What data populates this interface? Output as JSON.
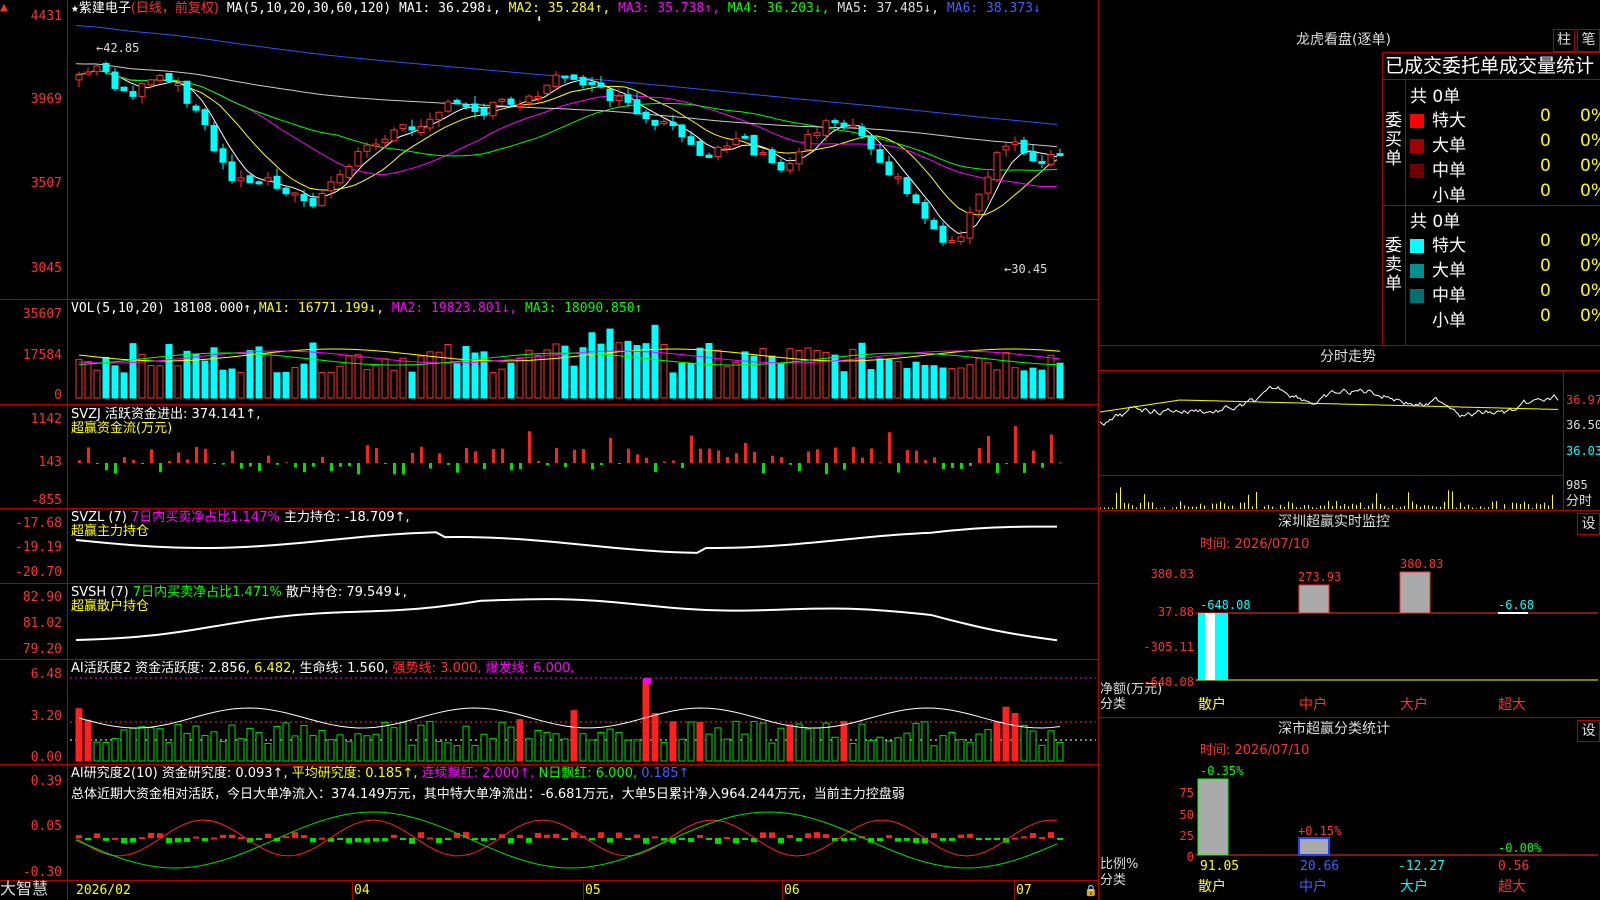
{
  "stock": {
    "star": "★",
    "name": "紫建电子",
    "period": "(日线，前复权)",
    "ma_header": "MA(5,10,20,30,60,120)",
    "ma_items": [
      {
        "label": "MA1: 36.298↓,",
        "color": "#ffffff"
      },
      {
        "label": "MA2: 35.284↑,",
        "color": "#ffff00"
      },
      {
        "label": "MA3: 35.738↑,",
        "color": "#ff00ff"
      },
      {
        "label": "MA4: 36.203↓,",
        "color": "#00ff00"
      },
      {
        "label": "MA5: 37.485↓,",
        "color": "#dddddd"
      },
      {
        "label": "MA6: 38.373↓",
        "color": "#4060ff"
      }
    ],
    "price_axis": [
      "4431",
      "3969",
      "3507",
      "3045"
    ],
    "high_marker": "←42.85",
    "low_marker": "←30.45"
  },
  "vol": {
    "header": "VOL(5,10,20)",
    "value": "18108.000↑,",
    "ma1": "MA1: 16771.199↓,",
    "ma2": "MA2: 19823.801↓,",
    "ma3": "MA3: 18090.850↑",
    "axis": [
      "35607",
      "17584",
      "0"
    ]
  },
  "svzj": {
    "header": "SVZJ",
    "text": "活跃资金进出: 374.141↑,",
    "sub": "超赢资金流(万元)",
    "axis": [
      "1142",
      "143",
      "-855"
    ]
  },
  "svzl": {
    "header": "SVZL (7)",
    "ratio": "7日内买卖净占比1.147%",
    "hold": "主力持仓: -18.709↑,",
    "sub": "超赢主力持仓",
    "axis": [
      "-17.68",
      "-19.19",
      "-20.70"
    ]
  },
  "svsh": {
    "header": "SVSH (7)",
    "ratio": "7日内买卖净占比1.471%",
    "hold": "散户持仓: 79.549↓,",
    "sub": "超赢散户持仓",
    "axis": [
      "82.90",
      "81.02",
      "79.20"
    ]
  },
  "ai_active": {
    "header": "AI活跃度2",
    "t1": "资金活跃度: 2.856",
    "t2": ", 6.482,",
    "t3": "生命线: 1.560,",
    "t4": "强势线: 3.000,",
    "t5": "爆发线: 6.000,",
    "axis": [
      "6.48",
      "3.20",
      "0.00"
    ]
  },
  "ai_research": {
    "header": "AI研究度2(10)",
    "t1": "资金研究度: 0.093↑,",
    "t2": "平均研究度: 0.185↑,",
    "t3": "连续飘红: 2.000↑,",
    "t4": "N日飘红: 6.000,",
    "t5": "0.185↑",
    "summary": "总体近期大资金相对活跃，今日大单净流入：374.149万元，其中特大单净流出：-6.681万元，大单5日累计净入964.244万元，当前主力控盘弱",
    "axis": [
      "0.39",
      "0.05",
      "-0.30"
    ]
  },
  "date_axis": [
    "2026/02",
    "04",
    "05",
    "06",
    "07"
  ],
  "brand": "大智慧",
  "right": {
    "dragon_title": "龙虎看盘(逐单)",
    "btn1": "柱",
    "btn2": "笔",
    "stat_title": "已成交委托单成交量统计",
    "buy_label": "委买单",
    "sell_label": "委卖单",
    "buy_total": "共 0单",
    "sell_total": "共 0单",
    "buy_rows": [
      {
        "name": "特大",
        "n": "0",
        "pct": "0%",
        "color": "#ff0000"
      },
      {
        "name": "大单",
        "n": "0",
        "pct": "0%",
        "color": "#a00000"
      },
      {
        "name": "中单",
        "n": "0",
        "pct": "0%",
        "color": "#700000"
      },
      {
        "name": "小单",
        "n": "0",
        "pct": "0%",
        "color": "#000000"
      }
    ],
    "sell_rows": [
      {
        "name": "特大",
        "n": "0",
        "pct": "0%",
        "color": "#00ffff"
      },
      {
        "name": "大单",
        "n": "0",
        "pct": "0%",
        "color": "#009090"
      },
      {
        "name": "中单",
        "n": "0",
        "pct": "0%",
        "color": "#007070"
      },
      {
        "name": "小单",
        "n": "0",
        "pct": "0%",
        "color": "#000000"
      }
    ],
    "intraday_title": "分时走势",
    "intraday_axis": [
      "36.97",
      "36.50",
      "36.03",
      "985"
    ],
    "intraday_btn": "分时",
    "monitor_title": "深圳超赢实时监控",
    "monitor_btn": "设",
    "monitor_time": "时间: 2026/07/10",
    "monitor_axis": [
      "380.83",
      "37.88",
      "-305.11",
      "-648.08"
    ],
    "monitor_values": [
      "-648.08",
      "273.93",
      "380.83",
      "-6.68"
    ],
    "monitor_ylabel": "净额(万元)",
    "monitor_xlabel": "分类",
    "monitor_cats": [
      "散户",
      "中户",
      "大户",
      "超大"
    ],
    "class_title": "深市超赢分类统计",
    "class_btn": "设",
    "class_time": "时间: 2026/07/10",
    "class_axis": [
      "75",
      "50",
      "25",
      "0"
    ],
    "class_top": [
      "-0.35%",
      "+0.15%",
      "-0.00%"
    ],
    "class_ylabel": "比例%",
    "class_xlabel": "分类",
    "class_bottom": [
      "91.05",
      "20.66",
      "-12.27",
      "0.56"
    ],
    "class_cats": [
      "散户",
      "中户",
      "大户",
      "超大"
    ]
  }
}
